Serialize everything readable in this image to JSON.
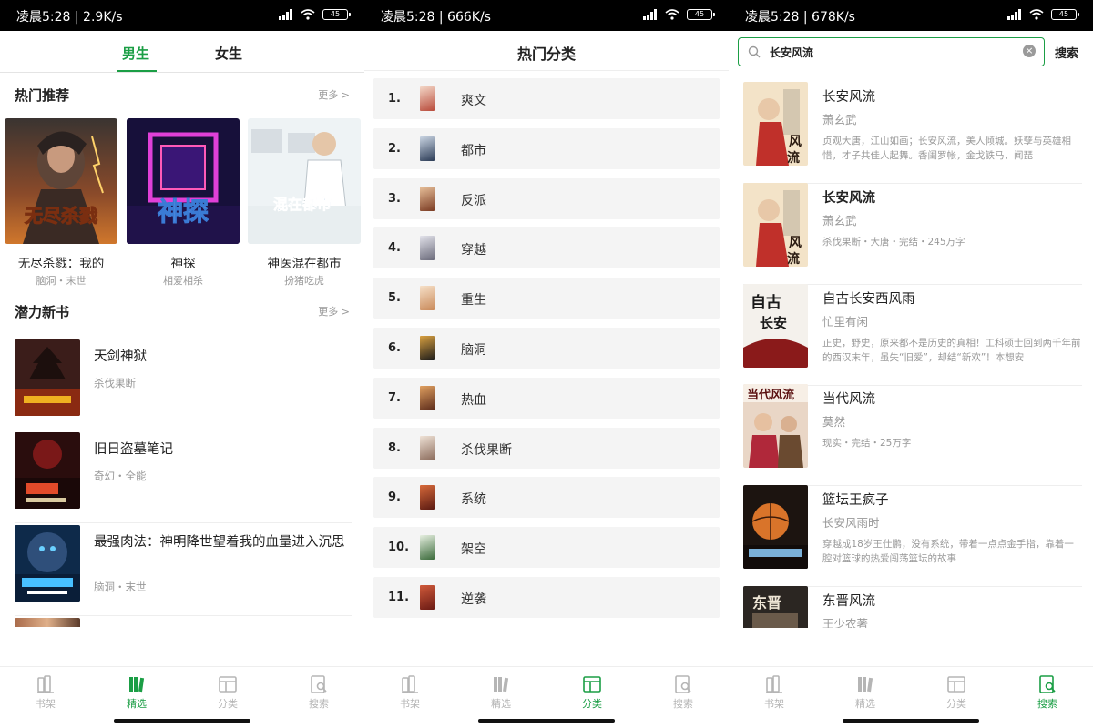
{
  "status_bars": [
    {
      "time": "凌晨5:28 | 2.9K/s",
      "battery": "45"
    },
    {
      "time": "凌晨5:28 | 666K/s",
      "battery": "45"
    },
    {
      "time": "凌晨5:28 | 678K/s",
      "battery": "45"
    }
  ],
  "bottom_nav": [
    {
      "label": "书架",
      "icon": "bookshelf-icon"
    },
    {
      "label": "精选",
      "icon": "featured-books-icon"
    },
    {
      "label": "分类",
      "icon": "category-icon"
    },
    {
      "label": "搜索",
      "icon": "search-book-icon"
    }
  ],
  "featured": {
    "tabs": [
      "男生",
      "女生"
    ],
    "hot": {
      "title": "热门推荐",
      "more": "更多 >",
      "books": [
        {
          "title": "无尽杀戮：我的",
          "meta": "脑洞・末世",
          "cover_text": "无尽杀戮"
        },
        {
          "title": "神探",
          "meta": "相爱相杀",
          "cover_text": "神探"
        },
        {
          "title": "神医混在都市",
          "meta": "扮猪吃虎",
          "cover_text": "混在都市"
        }
      ]
    },
    "new": {
      "title": "潜力新书",
      "more": "更多 >",
      "books": [
        {
          "title": "天剑神狱",
          "meta": "杀伐果断"
        },
        {
          "title": "旧日盗墓笔记",
          "meta": "奇幻・全能"
        },
        {
          "title": "最强肉法：神明降世望着我的血量进入沉思",
          "meta": "脑洞・末世"
        }
      ]
    }
  },
  "categories": {
    "title": "热门分类",
    "items": [
      {
        "num": "1.",
        "name": "爽文"
      },
      {
        "num": "2.",
        "name": "都市"
      },
      {
        "num": "3.",
        "name": "反派"
      },
      {
        "num": "4.",
        "name": "穿越"
      },
      {
        "num": "5.",
        "name": "重生"
      },
      {
        "num": "6.",
        "name": "脑洞"
      },
      {
        "num": "7.",
        "name": "热血"
      },
      {
        "num": "8.",
        "name": "杀伐果断"
      },
      {
        "num": "9.",
        "name": "系统"
      },
      {
        "num": "10.",
        "name": "架空"
      },
      {
        "num": "11.",
        "name": "逆袭"
      }
    ]
  },
  "search": {
    "query": "长安风流",
    "button": "搜索",
    "results": [
      {
        "title": "长安风流",
        "author": "萧玄武",
        "desc": "贞观大唐，江山如画；长安风流，美人倾城。妖孽与英雄相惜，才子共佳人起舞。香闺罗帐，金戈铁马，闻琵"
      },
      {
        "title": "长安风流",
        "author": "萧玄武",
        "meta": "杀伐果断・大唐・完结・245万字"
      },
      {
        "title": "自古长安西风雨",
        "author": "忙里有闲",
        "desc": "正史，野史，原来都不是历史的真相！工科硕士回到两千年前的西汉末年，虽失“旧爱”，却结“新欢”！本想安"
      },
      {
        "title": "当代风流",
        "author": "莫然",
        "meta": "现实・完结・25万字"
      },
      {
        "title": "篮坛王疯子",
        "author": "长安风雨时",
        "desc": "穿越成18岁王仕鹏，没有系统，带着一点点金手指，靠着一腔对篮球的热爱闯荡篮坛的故事"
      },
      {
        "title": "东晋风流",
        "author": "王少农著"
      }
    ]
  },
  "colors": {
    "accent": "#1b9e45",
    "muted": "#999999",
    "row_bg": "#f4f4f4"
  }
}
